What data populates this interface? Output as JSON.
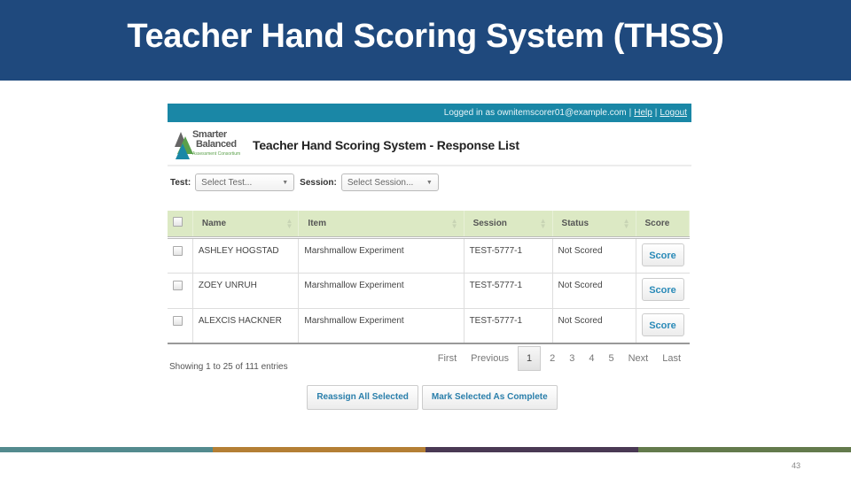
{
  "slide": {
    "title": "Teacher Hand Scoring System (THSS)",
    "page_number": "43",
    "bottom_bar_colors": [
      "#538a8e",
      "#b47f35",
      "#4a3954",
      "#637a4c"
    ],
    "header_color": "#1f497d"
  },
  "app": {
    "topbar": {
      "logged_in_text": "Logged in as ownitemscorer01@example.com",
      "help_label": "Help",
      "logout_label": "Logout",
      "separator": "|"
    },
    "brand": {
      "logo_line1": "Smarter",
      "logo_line2": "Balanced",
      "logo_line3": "Assessment Consortium",
      "title": "Teacher Hand Scoring System - Response List"
    },
    "filters": {
      "test_label": "Test:",
      "test_value": "Select Test...",
      "session_label": "Session:",
      "session_value": "Select Session..."
    },
    "table": {
      "columns": [
        "Name",
        "Item",
        "Session",
        "Status",
        "Score"
      ],
      "rows": [
        {
          "name": "ASHLEY HOGSTAD",
          "item": "Marshmallow Experiment",
          "session": "TEST-5777-1",
          "status": "Not Scored",
          "action": "Score"
        },
        {
          "name": "ZOEY UNRUH",
          "item": "Marshmallow Experiment",
          "session": "TEST-5777-1",
          "status": "Not Scored",
          "action": "Score"
        },
        {
          "name": "ALEXCIS HACKNER",
          "item": "Marshmallow Experiment",
          "session": "TEST-5777-1",
          "status": "Not Scored",
          "action": "Score"
        }
      ]
    },
    "entries_text": "Showing 1 to 25 of 111 entries",
    "pagination": {
      "first": "First",
      "previous": "Previous",
      "pages": [
        "1",
        "2",
        "3",
        "4",
        "5"
      ],
      "active_page": "1",
      "next": "Next",
      "last": "Last"
    },
    "actions": {
      "reassign_label": "Reassign All Selected",
      "complete_label": "Mark Selected As Complete"
    }
  }
}
